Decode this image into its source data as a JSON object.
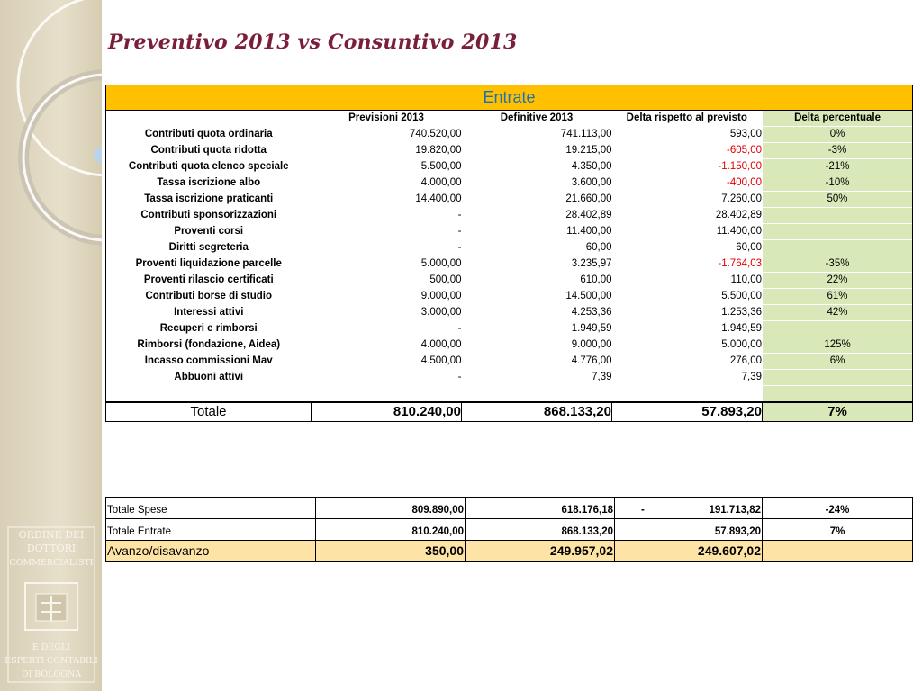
{
  "title": "Preventivo 2013 vs Consuntivo 2013",
  "entrate": {
    "heading": "Entrate",
    "columns": [
      "",
      "Previsioni 2013",
      "Definitive 2013",
      "Delta rispetto al previsto",
      "Delta percentuale"
    ],
    "rows": [
      {
        "label": "Contributi quota ordinaria",
        "prev": "740.520,00",
        "def": "741.113,00",
        "delta": "593,00",
        "pct": "0%",
        "neg": false
      },
      {
        "label": "Contributi quota ridotta",
        "prev": "19.820,00",
        "def": "19.215,00",
        "delta": "-605,00",
        "pct": "-3%",
        "neg": true
      },
      {
        "label": "Contributi quota elenco speciale",
        "prev": "5.500,00",
        "def": "4.350,00",
        "delta": "-1.150,00",
        "pct": "-21%",
        "neg": true
      },
      {
        "label": "Tassa iscrizione albo",
        "prev": "4.000,00",
        "def": "3.600,00",
        "delta": "-400,00",
        "pct": "-10%",
        "neg": true
      },
      {
        "label": "Tassa iscrizione praticanti",
        "prev": "14.400,00",
        "def": "21.660,00",
        "delta": "7.260,00",
        "pct": "50%",
        "neg": false
      },
      {
        "label": "Contributi sponsorizzazioni",
        "prev": "-",
        "def": "28.402,89",
        "delta": "28.402,89",
        "pct": "",
        "neg": false
      },
      {
        "label": "Proventi corsi",
        "prev": "-",
        "def": "11.400,00",
        "delta": "11.400,00",
        "pct": "",
        "neg": false
      },
      {
        "label": "Diritti segreteria",
        "prev": "-",
        "def": "60,00",
        "delta": "60,00",
        "pct": "",
        "neg": false
      },
      {
        "label": "Proventi liquidazione parcelle",
        "prev": "5.000,00",
        "def": "3.235,97",
        "delta": "-1.764,03",
        "pct": "-35%",
        "neg": true
      },
      {
        "label": "Proventi rilascio certificati",
        "prev": "500,00",
        "def": "610,00",
        "delta": "110,00",
        "pct": "22%",
        "neg": false
      },
      {
        "label": "Contributi borse di studio",
        "prev": "9.000,00",
        "def": "14.500,00",
        "delta": "5.500,00",
        "pct": "61%",
        "neg": false
      },
      {
        "label": "Interessi attivi",
        "prev": "3.000,00",
        "def": "4.253,36",
        "delta": "1.253,36",
        "pct": "42%",
        "neg": false
      },
      {
        "label": "Recuperi e rimborsi",
        "prev": "-",
        "def": "1.949,59",
        "delta": "1.949,59",
        "pct": "",
        "neg": false
      },
      {
        "label": "Rimborsi (fondazione, Aidea)",
        "prev": "4.000,00",
        "def": "9.000,00",
        "delta": "5.000,00",
        "pct": "125%",
        "neg": false
      },
      {
        "label": "Incasso commissioni Mav",
        "prev": "4.500,00",
        "def": "4.776,00",
        "delta": "276,00",
        "pct": "6%",
        "neg": false
      },
      {
        "label": "Abbuoni attivi",
        "prev": "-",
        "def": "7,39",
        "delta": "7,39",
        "pct": "",
        "neg": false
      }
    ],
    "total": {
      "label": "Totale",
      "prev": "810.240,00",
      "def": "868.133,20",
      "delta": "57.893,20",
      "pct": "7%"
    }
  },
  "summary": {
    "spese": {
      "label": "Totale Spese",
      "prev": "809.890,00",
      "def": "618.176,18",
      "delta_sign": "-",
      "delta": "191.713,82",
      "pct": "-24%"
    },
    "entrate": {
      "label": "Totale Entrate",
      "prev": "810.240,00",
      "def": "868.133,20",
      "delta": "57.893,20",
      "pct": "7%"
    },
    "avanzo": {
      "label": "Avanzo/disavanzo",
      "prev": "350,00",
      "def": "249.957,02",
      "delta": "249.607,02",
      "pct": ""
    }
  },
  "logo_text": "Ordine dei Dottori Commercialisti e degli Esperti Contabili di Bologna",
  "colors": {
    "title": "#7a1f3a",
    "header_bg": "#ffc000",
    "header_text": "#1f6fb5",
    "pct_bg": "#d8e8b8",
    "avanzo_bg": "#fde3a5",
    "negative": "#e00000"
  }
}
